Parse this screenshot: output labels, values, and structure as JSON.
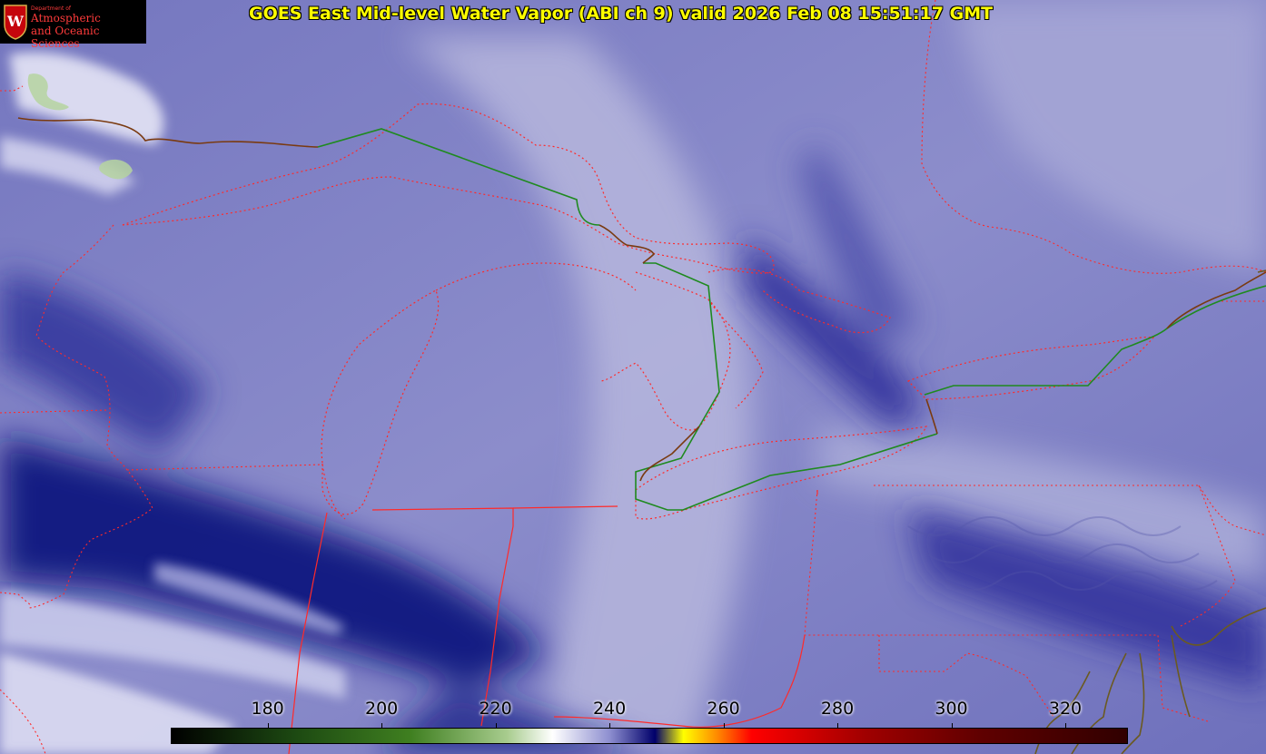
{
  "title": "GOES East Mid-level Water Vapor (ABI ch 9)  valid 2026 Feb 08 15:51:17 GMT",
  "logo": {
    "line1": "Department of",
    "line2": "Atmospheric",
    "line3": "and Oceanic Sciences",
    "seal_letter": "W"
  },
  "colorbar": {
    "ticks": [
      "180",
      "200",
      "220",
      "240",
      "260",
      "280",
      "300",
      "320"
    ],
    "tick_values": [
      180,
      200,
      220,
      240,
      260,
      280,
      300,
      320
    ],
    "value_range": [
      163,
      331
    ],
    "stops": [
      {
        "value": 163,
        "color": "#000000"
      },
      {
        "value": 185,
        "color": "#1d4a12"
      },
      {
        "value": 205,
        "color": "#3f7f20"
      },
      {
        "value": 222,
        "color": "#a8cc8e"
      },
      {
        "value": 230,
        "color": "#ffffff"
      },
      {
        "value": 240,
        "color": "#8e8fd0"
      },
      {
        "value": 248,
        "color": "#00006a"
      },
      {
        "value": 253,
        "color": "#ffff00"
      },
      {
        "value": 259,
        "color": "#ff8800"
      },
      {
        "value": 265,
        "color": "#ff0000"
      },
      {
        "value": 285,
        "color": "#a00000"
      },
      {
        "value": 305,
        "color": "#600000"
      },
      {
        "value": 331,
        "color": "#300000"
      }
    ]
  },
  "colors": {
    "title": "#ffff00",
    "state_borders": "#ff2a2a",
    "international_border": "#1f8a1f",
    "coastline": "#6b5a20",
    "logo_text": "#ff3b3b"
  }
}
